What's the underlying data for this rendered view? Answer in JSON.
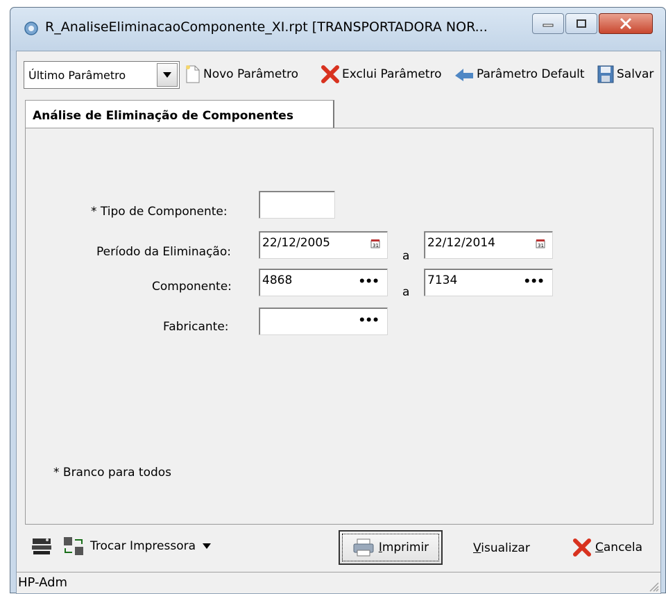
{
  "window": {
    "title": "R_AnaliseEliminacaoComponente_XI.rpt [TRANSPORTADORA NOR..."
  },
  "toolbar": {
    "param_select": "Último Parâmetro",
    "novo": "Novo Parâmetro",
    "exclui": "Exclui Parâmetro",
    "default": "Parâmetro Default",
    "salvar": "Salvar"
  },
  "tab": {
    "label": "Análise de Eliminação de Componentes"
  },
  "form": {
    "tipo_label": "* Tipo de Componente:",
    "tipo_value": "",
    "periodo_label": "Período da Eliminação:",
    "periodo_from": "22/12/2005",
    "periodo_to": "22/12/2014",
    "componente_label": "Componente:",
    "componente_from": "4868",
    "componente_to": "7134",
    "fabricante_label": "Fabricante:",
    "fabricante_value": "",
    "range_sep": "a",
    "note": "* Branco para todos"
  },
  "actions": {
    "trocar": "Trocar Impressora",
    "imprimir_u": "I",
    "imprimir_rest": "mprimir",
    "visualizar_u": "V",
    "visualizar_rest": "isualizar",
    "cancela_u": "C",
    "cancela_rest": "ancela"
  },
  "status": {
    "printer": "HP-Adm"
  }
}
